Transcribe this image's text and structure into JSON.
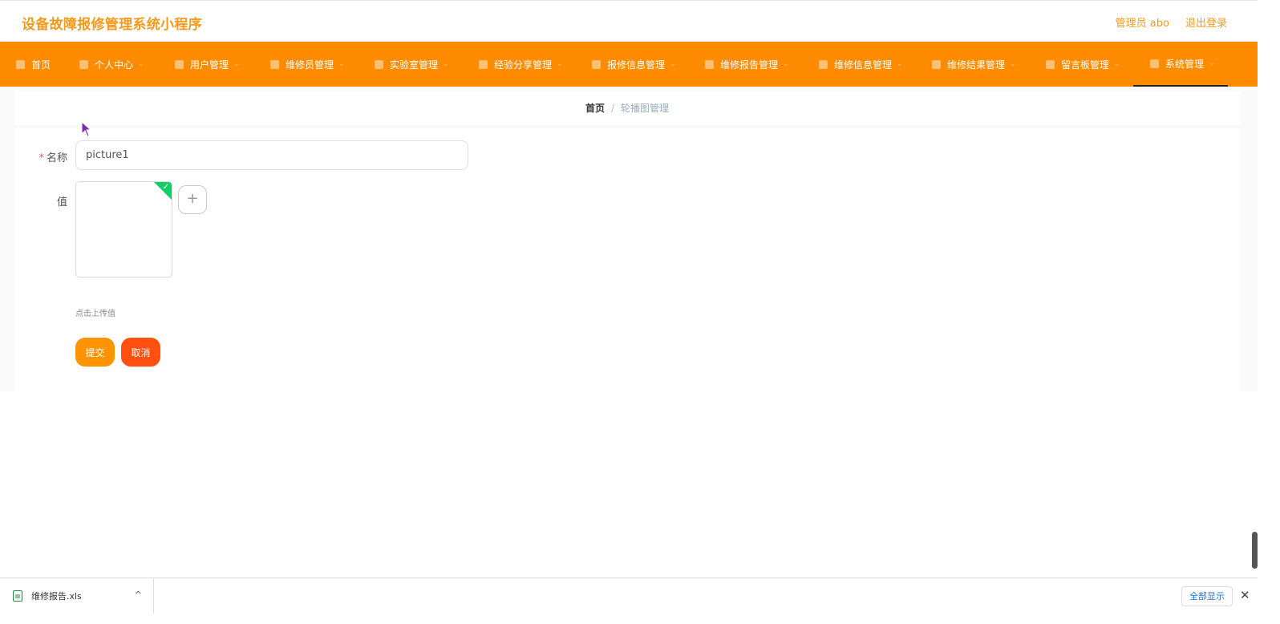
{
  "header": {
    "app_title": "设备故障报修管理系统小程序",
    "user_label": "管理员 abo",
    "logout_label": "退出登录"
  },
  "nav": {
    "items": [
      {
        "label": "首页",
        "icon": "home-icon"
      },
      {
        "label": "个人中心",
        "icon": "user-icon"
      },
      {
        "label": "用户管理",
        "icon": "list-icon"
      },
      {
        "label": "维修员管理",
        "icon": "send-icon"
      },
      {
        "label": "实验室管理",
        "icon": "fullscreen-icon"
      },
      {
        "label": "经验分享管理",
        "icon": "flag-icon"
      },
      {
        "label": "报修信息管理",
        "icon": "clipboard-icon"
      },
      {
        "label": "维修报告管理",
        "icon": "video-icon"
      },
      {
        "label": "维修信息管理",
        "icon": "document-icon"
      },
      {
        "label": "维修结果管理",
        "icon": "person-icon"
      },
      {
        "label": "留言板管理",
        "icon": "microphone-icon"
      },
      {
        "label": "系统管理",
        "icon": "copy-icon"
      }
    ],
    "active": "系统管理"
  },
  "breadcrumb": {
    "home": "首页",
    "separator": "/",
    "current": "轮播图管理"
  },
  "form": {
    "name_label": "名称",
    "name_value": "picture1",
    "value_label": "值",
    "upload_add_symbol": "+",
    "upload_hint": "点击上传值",
    "submit_label": "提交",
    "cancel_label": "取消"
  },
  "download_bar": {
    "file_name": "维修报告.xls",
    "show_all_label": "全部显示",
    "close_symbol": "✕",
    "expand_symbol": "^"
  },
  "colors": {
    "accent": "#ff8c00",
    "title": "#f39a1e",
    "submit": "#ff9400",
    "cancel": "#ff5010",
    "upload_success": "#13ce66"
  }
}
